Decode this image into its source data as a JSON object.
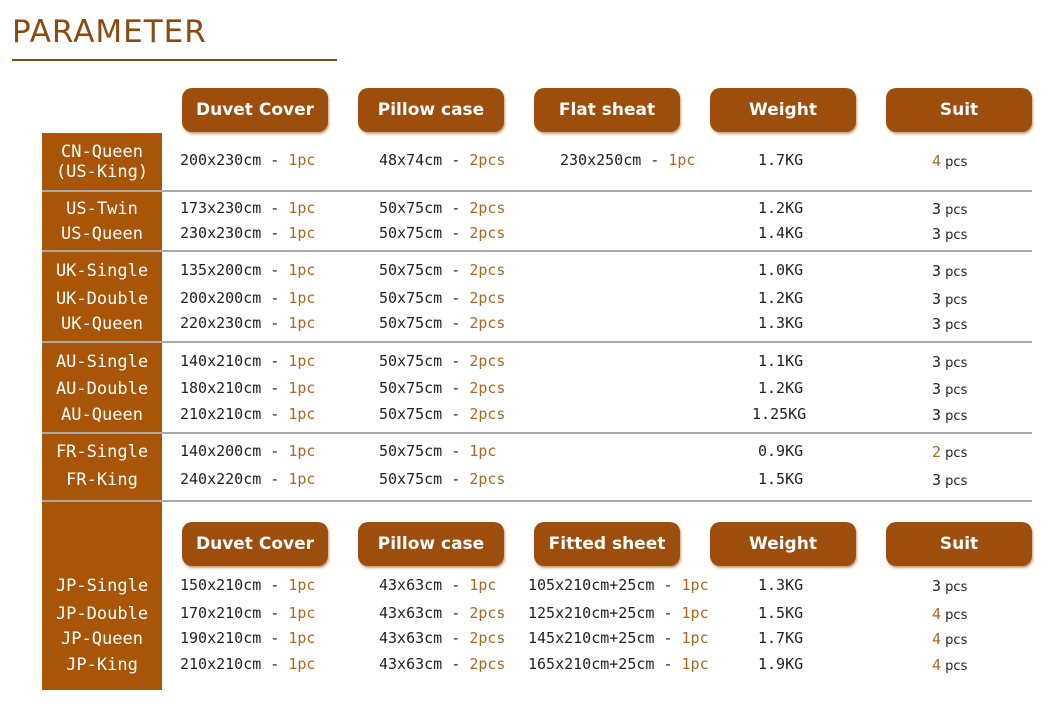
{
  "title": "PARAMETER",
  "headers_top": [
    "Duvet Cover",
    "Pillow case",
    "Flat sheat",
    "Weight",
    "Suit"
  ],
  "headers_jp": [
    "Duvet Cover",
    "Pillow case",
    "Fitted  sheet",
    "Weight",
    "Suit"
  ],
  "rows": [
    {
      "label": "CN-Queen\n(US-King)",
      "duvet": "200x230cm",
      "duvet_qty": "1pc",
      "pillow": "48x74cm",
      "pillow_qty": "2pcs",
      "sheet": "230x250cm",
      "sheet_qty": "1pc",
      "weight": "1.7KG",
      "suit": "4",
      "suit_unit": "pcs"
    },
    {
      "label": "US-Twin",
      "duvet": "173x230cm",
      "duvet_qty": "1pc",
      "pillow": "50x75cm",
      "pillow_qty": "2pcs",
      "sheet": "",
      "sheet_qty": "",
      "weight": "1.2KG",
      "suit": "3",
      "suit_unit": "pcs"
    },
    {
      "label": "US-Queen",
      "duvet": "230x230cm",
      "duvet_qty": "1pc",
      "pillow": "50x75cm",
      "pillow_qty": "2pcs",
      "sheet": "",
      "sheet_qty": "",
      "weight": "1.4KG",
      "suit": "3",
      "suit_unit": "pcs"
    },
    {
      "label": "UK-Single",
      "duvet": "135x200cm",
      "duvet_qty": "1pc",
      "pillow": "50x75cm",
      "pillow_qty": "2pcs",
      "sheet": "",
      "sheet_qty": "",
      "weight": "1.0KG",
      "suit": "3",
      "suit_unit": "pcs"
    },
    {
      "label": "UK-Double",
      "duvet": "200x200cm",
      "duvet_qty": "1pc",
      "pillow": "50x75cm",
      "pillow_qty": "2pcs",
      "sheet": "",
      "sheet_qty": "",
      "weight": "1.2KG",
      "suit": "3",
      "suit_unit": "pcs"
    },
    {
      "label": "UK-Queen",
      "duvet": "220x230cm",
      "duvet_qty": "1pc",
      "pillow": "50x75cm",
      "pillow_qty": "2pcs",
      "sheet": "",
      "sheet_qty": "",
      "weight": "1.3KG",
      "suit": "3",
      "suit_unit": "pcs"
    },
    {
      "label": "AU-Single",
      "duvet": "140x210cm",
      "duvet_qty": "1pc",
      "pillow": "50x75cm",
      "pillow_qty": "2pcs",
      "sheet": "",
      "sheet_qty": "",
      "weight": "1.1KG",
      "suit": "3",
      "suit_unit": "pcs"
    },
    {
      "label": "AU-Double",
      "duvet": "180x210cm",
      "duvet_qty": "1pc",
      "pillow": "50x75cm",
      "pillow_qty": "2pcs",
      "sheet": "",
      "sheet_qty": "",
      "weight": "1.2KG",
      "suit": "3",
      "suit_unit": "pcs"
    },
    {
      "label": "AU-Queen",
      "duvet": "210x210cm",
      "duvet_qty": "1pc",
      "pillow": "50x75cm",
      "pillow_qty": "2pcs",
      "sheet": "",
      "sheet_qty": "",
      "weight": "1.25KG",
      "suit": "3",
      "suit_unit": "pcs"
    },
    {
      "label": "FR-Single",
      "duvet": "140x200cm",
      "duvet_qty": "1pc",
      "pillow": "50x75cm",
      "pillow_qty": "1pc",
      "sheet": "",
      "sheet_qty": "",
      "weight": "0.9KG",
      "suit": "2",
      "suit_unit": "pcs"
    },
    {
      "label": "FR-King",
      "duvet": "240x220cm",
      "duvet_qty": "1pc",
      "pillow": "50x75cm",
      "pillow_qty": "2pcs",
      "sheet": "",
      "sheet_qty": "",
      "weight": "1.5KG",
      "suit": "3",
      "suit_unit": "pcs"
    },
    {
      "label": "JP-Single",
      "duvet": "150x210cm",
      "duvet_qty": "1pc",
      "pillow": "43x63cm",
      "pillow_qty": "1pc",
      "sheet": "105x210cm+25cm",
      "sheet_qty": "1pc",
      "weight": "1.3KG",
      "suit": "3",
      "suit_unit": "pcs"
    },
    {
      "label": "JP-Double",
      "duvet": "170x210cm",
      "duvet_qty": "1pc",
      "pillow": "43x63cm",
      "pillow_qty": "2pcs",
      "sheet": "125x210cm+25cm",
      "sheet_qty": "1pc",
      "weight": "1.5KG",
      "suit": "4",
      "suit_unit": "pcs"
    },
    {
      "label": "JP-Queen",
      "duvet": "190x210cm",
      "duvet_qty": "1pc",
      "pillow": "43x63cm",
      "pillow_qty": "2pcs",
      "sheet": "145x210cm+25cm",
      "sheet_qty": "1pc",
      "weight": "1.7KG",
      "suit": "4",
      "suit_unit": "pcs"
    },
    {
      "label": "JP-King",
      "duvet": "210x210cm",
      "duvet_qty": "1pc",
      "pillow": "43x63cm",
      "pillow_qty": "2pcs",
      "sheet": "165x210cm+25cm",
      "sheet_qty": "1pc",
      "weight": "1.9KG",
      "suit": "4",
      "suit_unit": "pcs"
    }
  ],
  "colors": {
    "brand": "#9d4d0c",
    "label_bg": "#a85508",
    "accent_text": "#a86a24",
    "rule": "#a9a9a9"
  }
}
